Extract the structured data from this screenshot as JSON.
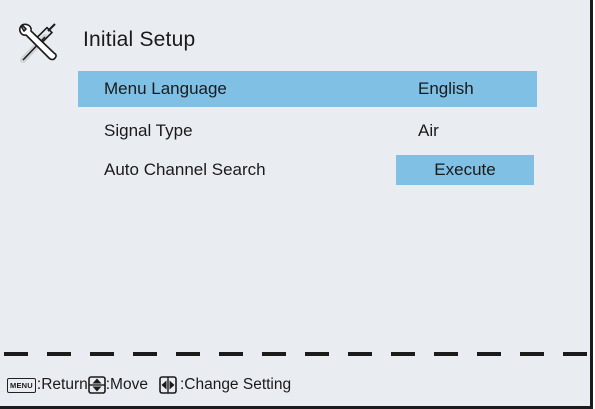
{
  "header": {
    "title": "Initial Setup",
    "icon": "wrench-screwdriver-icon"
  },
  "menu": {
    "items": [
      {
        "label": "Menu Language",
        "value": "English",
        "selected": true
      },
      {
        "label": "Signal Type",
        "value": "Air",
        "selected": false
      },
      {
        "label": "Auto Channel Search",
        "value": "Execute",
        "selected": false
      }
    ]
  },
  "footer": {
    "menu_key": "MENU",
    "return_label": ":Return",
    "move_label": ":Move",
    "change_label": ":Change Setting"
  },
  "colors": {
    "background": "#e9edf1",
    "highlight": "#7fc0e4",
    "text": "#1a1a1a"
  }
}
